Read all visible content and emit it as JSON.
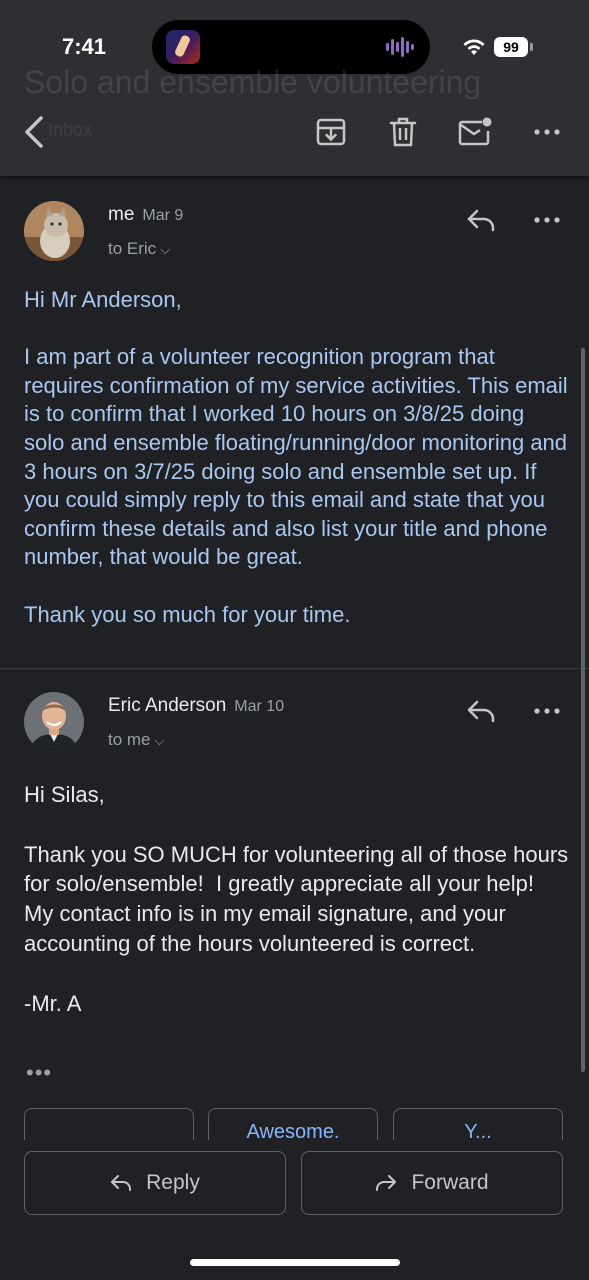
{
  "status_bar": {
    "time": "7:41",
    "battery": "99"
  },
  "toolbar": {
    "ghost_title": "Solo and ensemble volunteering",
    "ghost_subtitle": "Inbox",
    "icons": [
      "back-arrow-icon",
      "archive-icon",
      "trash-icon",
      "mark-unread-icon",
      "more-icon"
    ]
  },
  "messages": [
    {
      "sender": "me",
      "date": "Mar 9",
      "to": "to Eric",
      "body": "Hi Mr Anderson,\n\nI am part of a volunteer recognition program that requires confirmation of my service activities. This email is to confirm that I worked 10 hours on 3/8/25 doing solo and ensemble floating/running/door monitoring and 3 hours on 3/7/25 doing solo and ensemble set up. If you could simply reply to this email and state that you confirm these details and also list your title and phone number, that would be great.\n\nThank you so much for your time."
    },
    {
      "sender": "Eric Anderson",
      "date": "Mar 10",
      "to": "to me",
      "body": "Hi Silas,\n\nThank you SO MUCH for volunteering all of those hours for solo/ensemble!  I greatly appreciate all your help!  My contact info is in my email signature, and your accounting of the hours volunteered is correct.\n\n-Mr. A",
      "trimmed": "•••"
    }
  ],
  "smart_replies": [
    "",
    "Awesome.",
    "Y..."
  ],
  "actions": {
    "reply": "Reply",
    "forward": "Forward"
  },
  "colors": {
    "background": "#202124",
    "toolbar": "#2e2f32",
    "link_blue": "#a9c7f0",
    "accent": "#8ab4f8"
  }
}
